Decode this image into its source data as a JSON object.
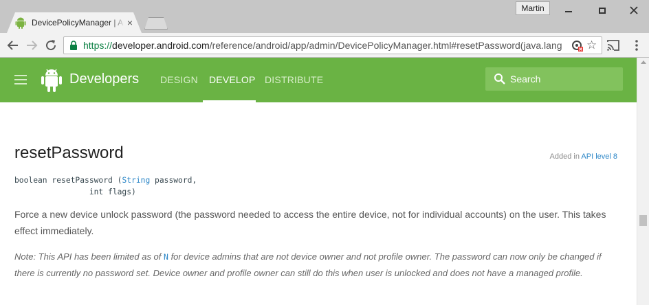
{
  "browser": {
    "tab_title": "DevicePolicyManager | Android Developers",
    "tab_close": "×",
    "profile_name": "Martin",
    "url_scheme": "https://",
    "url_host": "developer.android.com",
    "url_path": "/reference/android/app/admin/DevicePolicyManager.html#resetPassword(java.lang",
    "icons": {
      "back": "arrow-back-icon",
      "forward": "arrow-forward-icon",
      "reload": "reload-icon",
      "lock": "lock-icon",
      "star": "star-icon",
      "cast": "cast-icon",
      "menu": "kebab-menu-icon"
    }
  },
  "site": {
    "brand": "Developers",
    "nav": [
      "DESIGN",
      "DEVELOP",
      "DISTRIBUTE"
    ],
    "active_nav": "DEVELOP",
    "search_label": "Search",
    "colors": {
      "header": "#6ab344",
      "search": "#82c25d",
      "link": "#2b86c7"
    }
  },
  "content": {
    "method_title": "resetPassword",
    "added_prefix": "Added in ",
    "added_link": "API level 8",
    "signature": {
      "line1_prefix": "boolean resetPassword (",
      "line1_type": "String",
      "line1_suffix": " password,",
      "line2": "                int flags)"
    },
    "description": "Force a new device unlock password (the password needed to access the entire device, not for individual accounts) on the user. This takes effect immediately.",
    "note": {
      "before": "Note: This API has been limited as of ",
      "code": "N",
      "after": " for device admins that are not device owner and not profile owner. The password can now only be changed if there is currently no password set. Device owner and profile owner can still do this when user is unlocked and does not have a managed profile."
    }
  }
}
